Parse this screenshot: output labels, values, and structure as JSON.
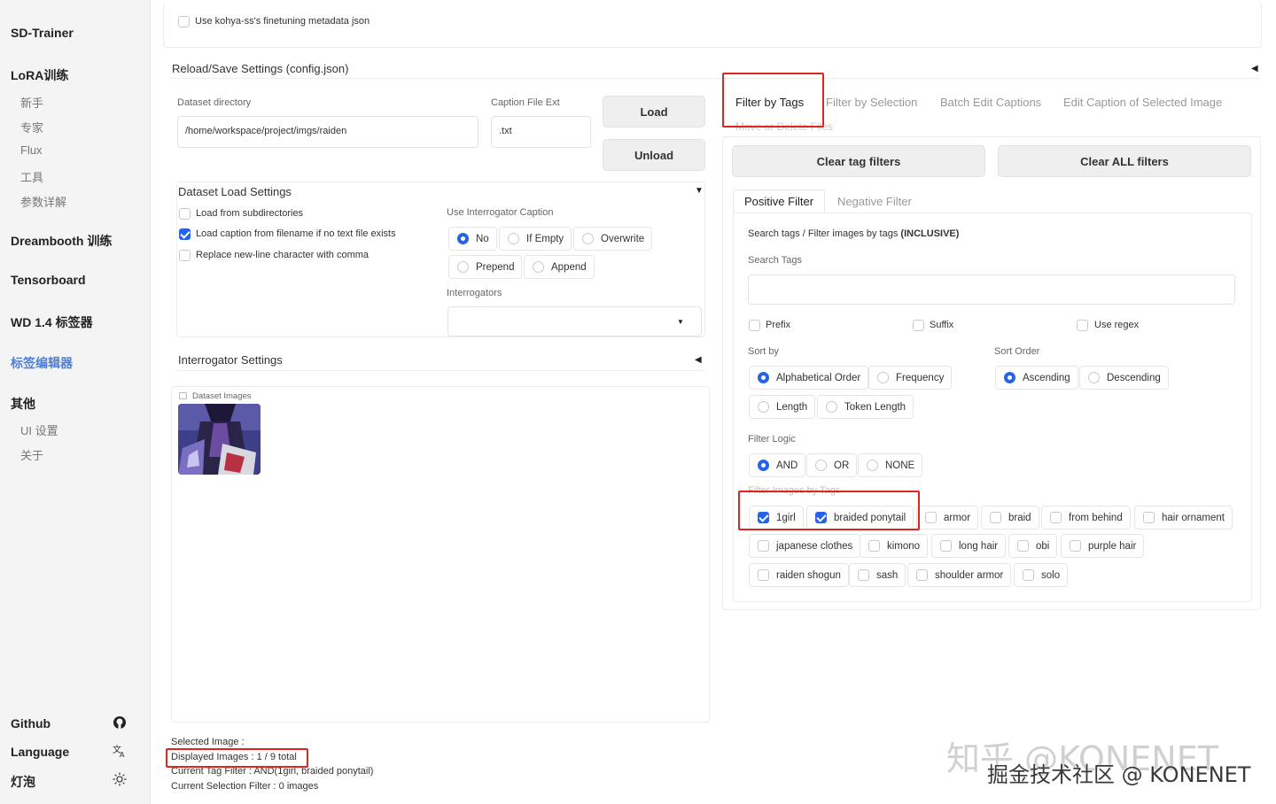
{
  "sidebar": {
    "app_title": "SD-Trainer",
    "lora_header": "LoRA训练",
    "lora_items": [
      "新手",
      "专家",
      "Flux",
      "工具",
      "参数详解"
    ],
    "dreambooth": "Dreambooth 训练",
    "tensorboard": "Tensorboard",
    "wd_tagger": "WD 1.4 标签器",
    "tag_editor": "标签编辑器",
    "other_header": "其他",
    "other_items": [
      "UI 设置",
      "关于"
    ],
    "github": "Github",
    "language": "Language",
    "lightbulb": "灯泡"
  },
  "top": {
    "kohya_checkbox": "Use kohya-ss's finetuning metadata json",
    "kohya_checked": false
  },
  "reload_save": {
    "title": "Reload/Save Settings (config.json)"
  },
  "dataset": {
    "dir_label": "Dataset directory",
    "dir_value": "/home/workspace/project/imgs/raiden",
    "ext_label": "Caption File Ext",
    "ext_value": ".txt",
    "load_label": "Load",
    "unload_label": "Unload"
  },
  "load_settings": {
    "title": "Dataset Load Settings",
    "checkboxes": [
      {
        "label": "Load from subdirectories",
        "checked": false
      },
      {
        "label": "Load caption from filename if no text file exists",
        "checked": true
      },
      {
        "label": "Replace new-line character with comma",
        "checked": false
      }
    ],
    "interrogator_caption_label": "Use Interrogator Caption",
    "interrogator_options": [
      "No",
      "If Empty",
      "Overwrite",
      "Prepend",
      "Append"
    ],
    "interrogator_selected": "No",
    "interrogators_label": "Interrogators",
    "interrogators_value": ""
  },
  "interrogator_settings": {
    "title": "Interrogator Settings"
  },
  "gallery": {
    "label": "Dataset Images"
  },
  "status": {
    "selected_image": "Selected Image :",
    "displayed_images": "Displayed Images : 1 / 9 total",
    "current_tag_filter": "Current Tag Filter : AND(1girl, braided ponytail)",
    "current_selection_filter": "Current Selection Filter : 0 images"
  },
  "right_tabs": {
    "tabs": [
      "Filter by Tags",
      "Filter by Selection",
      "Batch Edit Captions",
      "Edit Caption of Selected Image"
    ],
    "active": "Filter by Tags",
    "overflow_tab": "Move or Delete Files"
  },
  "filter": {
    "clear_tag_filters": "Clear tag filters",
    "clear_all_filters": "Clear ALL filters",
    "positive_tab": "Positive Filter",
    "negative_tab": "Negative Filter",
    "search_heading_prefix": "Search tags / Filter images by tags ",
    "search_heading_bold": "(INCLUSIVE)",
    "search_tags_label": "Search Tags",
    "search_value": "",
    "prefix": "Prefix",
    "suffix": "Suffix",
    "use_regex": "Use regex",
    "sort_by_label": "Sort by",
    "sort_by_options": [
      "Alphabetical Order",
      "Frequency",
      "Length",
      "Token Length"
    ],
    "sort_by_selected": "Alphabetical Order",
    "sort_order_label": "Sort Order",
    "sort_order_options": [
      "Ascending",
      "Descending"
    ],
    "sort_order_selected": "Ascending",
    "filter_logic_label": "Filter Logic",
    "filter_logic_options": [
      "AND",
      "OR",
      "NONE"
    ],
    "filter_logic_selected": "AND",
    "filter_images_label": "Filter Images by Tags",
    "tags": [
      {
        "label": "1girl",
        "checked": true
      },
      {
        "label": "braided ponytail",
        "checked": true
      },
      {
        "label": "armor",
        "checked": false
      },
      {
        "label": "braid",
        "checked": false
      },
      {
        "label": "from behind",
        "checked": false
      },
      {
        "label": "hair ornament",
        "checked": false
      },
      {
        "label": "japanese clothes",
        "checked": false
      },
      {
        "label": "kimono",
        "checked": false
      },
      {
        "label": "long hair",
        "checked": false
      },
      {
        "label": "obi",
        "checked": false
      },
      {
        "label": "purple hair",
        "checked": false
      },
      {
        "label": "raiden shogun",
        "checked": false
      },
      {
        "label": "sash",
        "checked": false
      },
      {
        "label": "shoulder armor",
        "checked": false
      },
      {
        "label": "solo",
        "checked": false
      }
    ]
  },
  "watermark": {
    "line1": "知乎 @KONENET",
    "line2": "掘金技术社区 @ KONENET"
  },
  "colors": {
    "accent": "#2563eb",
    "highlight_box": "#e02424",
    "sidebar_active": "#4f7fd8"
  }
}
